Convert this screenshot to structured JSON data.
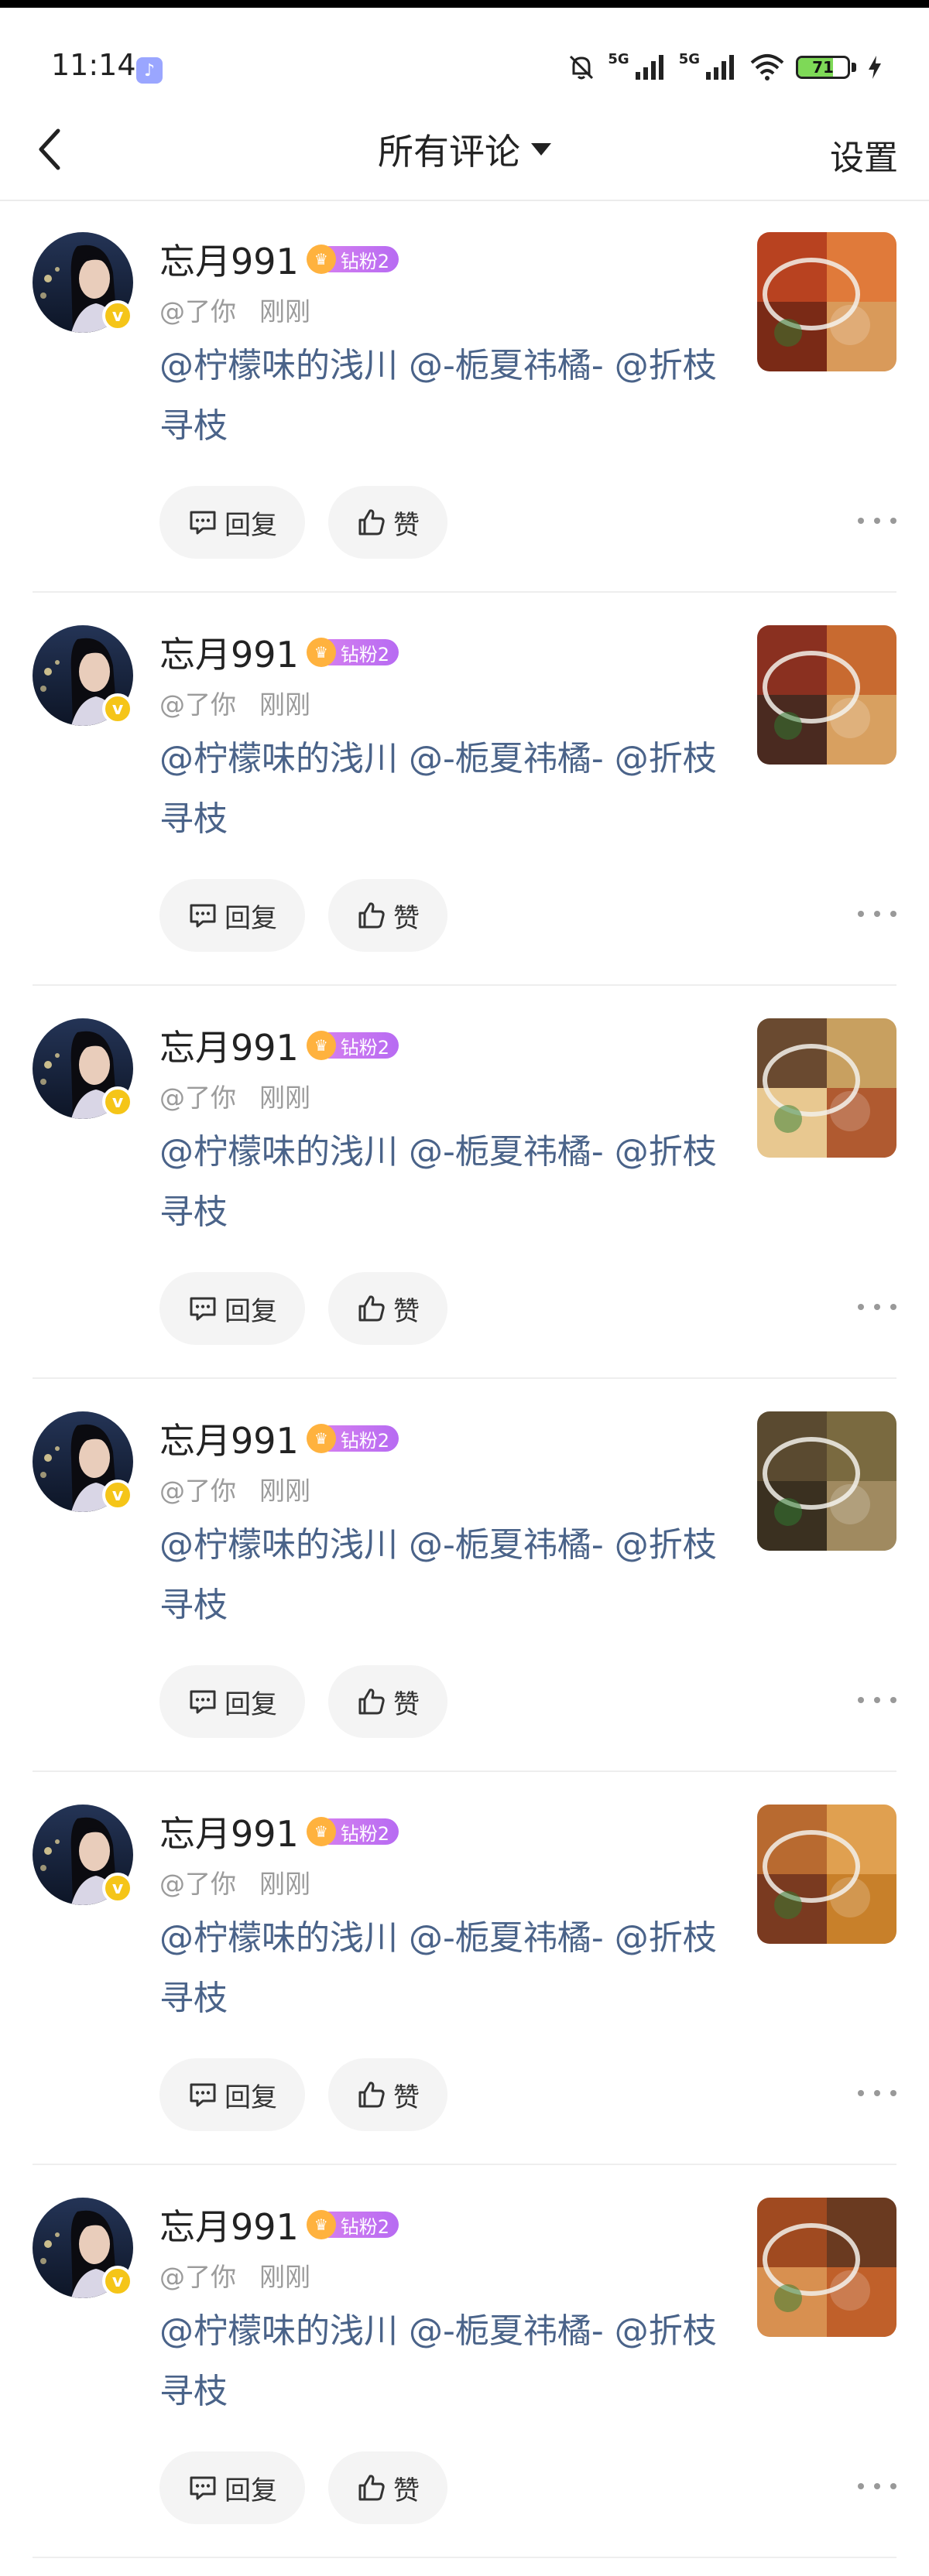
{
  "status_bar": {
    "time": "11:14",
    "signal_label_1": "5G",
    "signal_label_2": "5G",
    "battery_text": "71",
    "battery_level": 0.71,
    "icons": [
      "tiktok-app-icon",
      "mute-bell-icon",
      "signal-icon",
      "signal-icon",
      "wifi-icon",
      "battery-icon",
      "charging-bolt-icon"
    ]
  },
  "header": {
    "title": "所有评论",
    "settings_label": "设置",
    "back_icon": "chevron-left-icon",
    "dropdown_icon": "caret-down-icon"
  },
  "comments": [
    {
      "username": "忘月991",
      "fan_badge": "钻粉2",
      "mention": "@了你",
      "time": "刚刚",
      "text": "@柠檬味的浅川 @-栀夏祎橘- @折枝寻枝",
      "reply_label": "回复",
      "like_label": "赞",
      "thumb_colors": [
        "#b84220",
        "#e07a3a",
        "#7a2a16",
        "#d99a5a"
      ]
    },
    {
      "username": "忘月991",
      "fan_badge": "钻粉2",
      "mention": "@了你",
      "time": "刚刚",
      "text": "@柠檬味的浅川 @-栀夏祎橘- @折枝寻枝",
      "reply_label": "回复",
      "like_label": "赞",
      "thumb_colors": [
        "#8a3020",
        "#c86a30",
        "#4a2a20",
        "#d8a060"
      ]
    },
    {
      "username": "忘月991",
      "fan_badge": "钻粉2",
      "mention": "@了你",
      "time": "刚刚",
      "text": "@柠檬味的浅川 @-栀夏祎橘- @折枝寻枝",
      "reply_label": "回复",
      "like_label": "赞",
      "thumb_colors": [
        "#6a4a30",
        "#c8a060",
        "#e8c890",
        "#b05a30"
      ]
    },
    {
      "username": "忘月991",
      "fan_badge": "钻粉2",
      "mention": "@了你",
      "time": "刚刚",
      "text": "@柠檬味的浅川 @-栀夏祎橘- @折枝寻枝",
      "reply_label": "回复",
      "like_label": "赞",
      "thumb_colors": [
        "#5a4a30",
        "#7a6a40",
        "#3a3020",
        "#a08a60"
      ]
    },
    {
      "username": "忘月991",
      "fan_badge": "钻粉2",
      "mention": "@了你",
      "time": "刚刚",
      "text": "@柠檬味的浅川 @-栀夏祎橘- @折枝寻枝",
      "reply_label": "回复",
      "like_label": "赞",
      "thumb_colors": [
        "#b86a30",
        "#e0a050",
        "#7a3a20",
        "#c8802a"
      ]
    },
    {
      "username": "忘月991",
      "fan_badge": "钻粉2",
      "mention": "@了你",
      "time": "刚刚",
      "text": "@柠檬味的浅川 @-栀夏祎橘- @折枝寻枝",
      "reply_label": "回复",
      "like_label": "赞",
      "thumb_colors": [
        "#a04a20",
        "#6a3a20",
        "#d89050",
        "#c0602a"
      ]
    }
  ],
  "colors": {
    "mention_text": "#4a6389",
    "meta_text": "#9b9b9b",
    "pill_bg": "#f4f4f4",
    "verified_badge": "#f5c518",
    "fan_badge": "#c173f1"
  }
}
